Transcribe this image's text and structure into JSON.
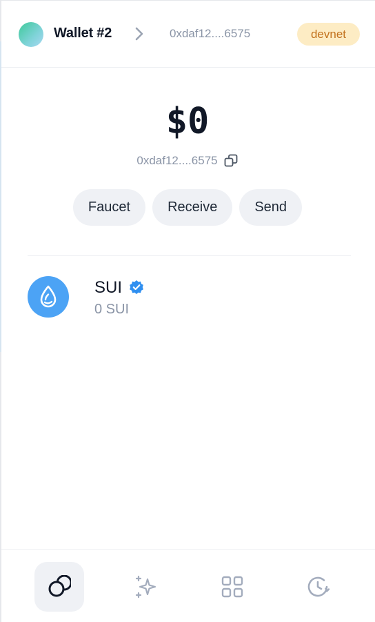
{
  "header": {
    "wallet_name": "Wallet #2",
    "address": "0xdaf12....6575",
    "network": "devnet"
  },
  "balance": {
    "amount": "$0",
    "address": "0xdaf12....6575"
  },
  "actions": {
    "faucet": "Faucet",
    "receive": "Receive",
    "send": "Send"
  },
  "coins": [
    {
      "symbol": "SUI",
      "amount": "0 SUI",
      "icon": "sui-drop-icon",
      "verified": true
    }
  ],
  "bottom_nav": {
    "items": [
      {
        "icon": "tokens-icon",
        "active": true
      },
      {
        "icon": "sparkle-icon",
        "active": false
      },
      {
        "icon": "apps-grid-icon",
        "active": false
      },
      {
        "icon": "history-icon",
        "active": false
      }
    ]
  },
  "colors": {
    "accent_blue": "#4ca3f5",
    "badge_bg": "#fdecc4",
    "badge_text": "#c2711c",
    "muted_text": "#8a94a6",
    "pill_bg": "#eff1f5"
  }
}
